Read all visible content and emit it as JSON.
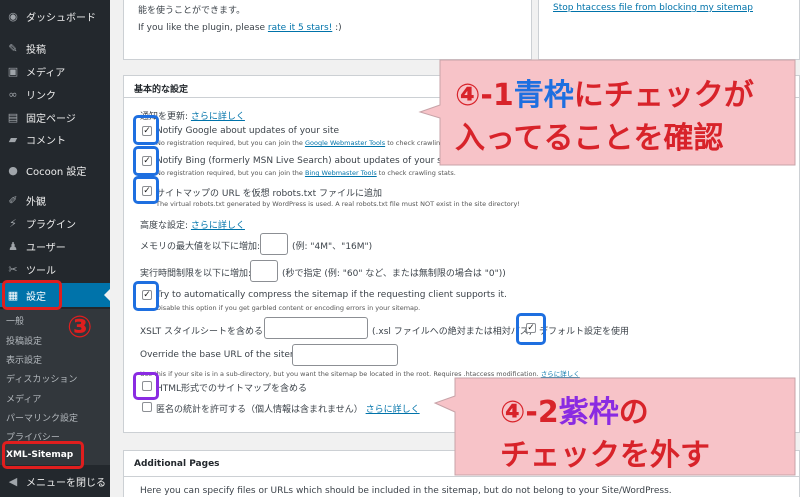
{
  "sidebar": {
    "items": [
      {
        "label": "ダッシュボード",
        "icon": "dashboard-icon",
        "glyph": "◉"
      },
      {
        "label": "投稿",
        "icon": "pin-icon",
        "glyph": "✎"
      },
      {
        "label": "メディア",
        "icon": "media-icon",
        "glyph": "▣"
      },
      {
        "label": "リンク",
        "icon": "link-icon",
        "glyph": "∞"
      },
      {
        "label": "固定ページ",
        "icon": "page-icon",
        "glyph": "▤"
      },
      {
        "label": "コメント",
        "icon": "comment-icon",
        "glyph": "▰"
      },
      {
        "label": "Cocoon 設定",
        "icon": "cocoon-icon",
        "glyph": "●"
      },
      {
        "label": "外観",
        "icon": "appearance-icon",
        "glyph": "✐"
      },
      {
        "label": "プラグイン",
        "icon": "plugin-icon",
        "glyph": "⚡"
      },
      {
        "label": "ユーザー",
        "icon": "user-icon",
        "glyph": "♟"
      },
      {
        "label": "ツール",
        "icon": "tool-icon",
        "glyph": "✂"
      },
      {
        "label": "設定",
        "icon": "settings-icon",
        "glyph": "▦"
      }
    ],
    "submenu": [
      "一般",
      "投稿設定",
      "表示設定",
      "ディスカッション",
      "メディア",
      "パーマリンク設定",
      "プライバシー",
      "XML-Sitemap"
    ],
    "collapse_label": "メニューを閉じる",
    "collapse_glyph": "◀"
  },
  "top_box": {
    "line1": "能を使うことができます。",
    "rate_prefix": "If you like the plugin, please ",
    "rate_link": "rate it 5 stars!",
    "rate_suffix": " :)",
    "side_link": "Stop htaccess file from blocking my sitemap"
  },
  "basic": {
    "title": "基本的な設定",
    "update_label": "通知を更新:",
    "more_link": "さらに詳しく",
    "notify_google": "Notify Google about updates of your site",
    "notify_google_small_pre": "No registration required, but you can join the ",
    "notify_google_small_link": "Google Webmaster Tools",
    "notify_google_small_post": " to check crawling stats.",
    "notify_bing": "Notify Bing (formerly MSN Live Search) about updates of your site",
    "notify_bing_small_pre": "No registration required, but you can join the ",
    "notify_bing_small_link": "Bing Webmaster Tools",
    "notify_bing_small_post": " to check crawling stats.",
    "robots": "サイトマップの URL を仮想 robots.txt ファイルに追加",
    "robots_small": "The virtual robots.txt generated by WordPress is used. A real robots.txt file must NOT exist in the site directory!",
    "advanced_label": "高度な設定:",
    "memory_label": "メモリの最大値を以下に増加:",
    "memory_hint": "(例: \"4M\"、\"16M\")",
    "exec_label": "実行時間制限を以下に増加:",
    "exec_hint": "(秒で指定 (例: \"60\" など、または無制限の場合は \"0\"))",
    "compress": "Try to automatically compress the sitemap if the requesting client supports it.",
    "compress_small": "Disable this option if you get garbled content or encoding errors in your sitemap.",
    "xslt_label": "XSLT スタイルシートを含める:",
    "xslt_hint": "(.xsl ファイルへの絶対または相対パス)",
    "xslt_default": "デフォルト設定を使用",
    "baseurl_label": "Override the base URL of the sitemap:",
    "baseurl_small": "Use this if your site is in a sub-directory, but you want the sitemap be located in the root. Requires .htaccess modification.",
    "html_sitemap": "HTML形式でのサイトマップを含める",
    "anon_stats": "匿名の統計を許可する（個人情報は含まれません）",
    "check": "✓"
  },
  "additional": {
    "title": "Additional Pages",
    "desc": "Here you can specify files or URLs which should be included in the sitemap, but do not belong to your Site/WordPress."
  },
  "annotations": {
    "callout1_line1_a": "④-1",
    "callout1_line1_b": "青枠",
    "callout1_line1_c": "にチェックが",
    "callout1_line2": "入ってることを確認",
    "callout2_line1_a": "④-2",
    "callout2_line1_b": "紫枠",
    "callout2_line1_c": "の",
    "callout2_line2": "チェックを外す",
    "circle3": "③",
    "callout_fill": "#f7c3c8",
    "red": "#e01e1e",
    "blue": "#1e6fe0",
    "purple": "#8a2be2"
  }
}
